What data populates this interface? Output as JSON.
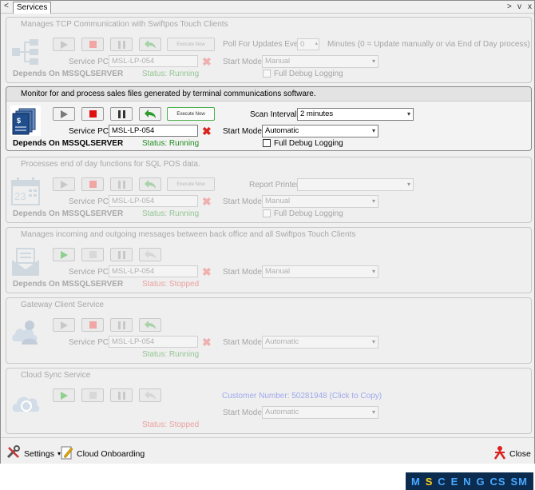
{
  "tab": {
    "back": "<",
    "title": "Services",
    "ctl_prev": ">",
    "ctl_menu": "v",
    "ctl_close": "x"
  },
  "common": {
    "service_pc_label": "Service PC:",
    "start_mode_label": "Start Mode:",
    "full_debug_label": "Full Debug Logging",
    "execute_now": "Execute Now",
    "depends_prefix": "Depends On",
    "pc_value": "MSL-LP-054"
  },
  "panels": [
    {
      "title": "Manages TCP Communication with Swiftpos Touch Clients",
      "icon": "network-icon",
      "extra_label": "Poll For Updates Every:",
      "extra_value": "0",
      "extra_note": "Minutes (0 = Update manually or via End of Day process)",
      "start_mode": "Manual",
      "depends": "MSSQLSERVER",
      "status": "Status: Running"
    },
    {
      "title": "Monitor for and process sales files generated by terminal communications software.",
      "icon": "sales-files-icon",
      "extra_label": "Scan Interval:",
      "extra_value": "2 minutes",
      "start_mode": "Automatic",
      "depends": "MSSQLSERVER",
      "status": "Status: Running"
    },
    {
      "title": "Processes end of day functions for SQL POS data.",
      "icon": "calendar-icon",
      "calendar_text": "23",
      "extra_label": "Report Printer:",
      "extra_value": "",
      "start_mode": "Manual",
      "depends": "MSSQLSERVER",
      "status": "Status: Running"
    },
    {
      "title": "Manages incoming and outgoing messages between back office and all Swiftpos Touch Clients",
      "icon": "envelope-icon",
      "start_mode": "Manual",
      "depends": "MSSQLSERVER",
      "status": "Status: Stopped"
    },
    {
      "title": "Gateway Client Service",
      "icon": "cloud-user-icon",
      "start_mode": "Automatic",
      "status": "Status: Running"
    },
    {
      "title": "Cloud Sync Service",
      "icon": "cloud-sync-icon",
      "customer": "Customer Number: 50281948 (Click to Copy)",
      "start_mode": "Automatic",
      "status": "Status: Stopped"
    }
  ],
  "footer": {
    "settings": "Settings",
    "cloud_onboarding": "Cloud Onboarding",
    "close": "Close"
  },
  "brand": {
    "letters": [
      "M",
      "S",
      "C",
      "E",
      "N",
      "G",
      "CS",
      "SM"
    ]
  },
  "colors": {
    "accent_red": "#d9231f",
    "status_running": "#1f8b1f",
    "brand_bg": "#0b2c4f"
  }
}
